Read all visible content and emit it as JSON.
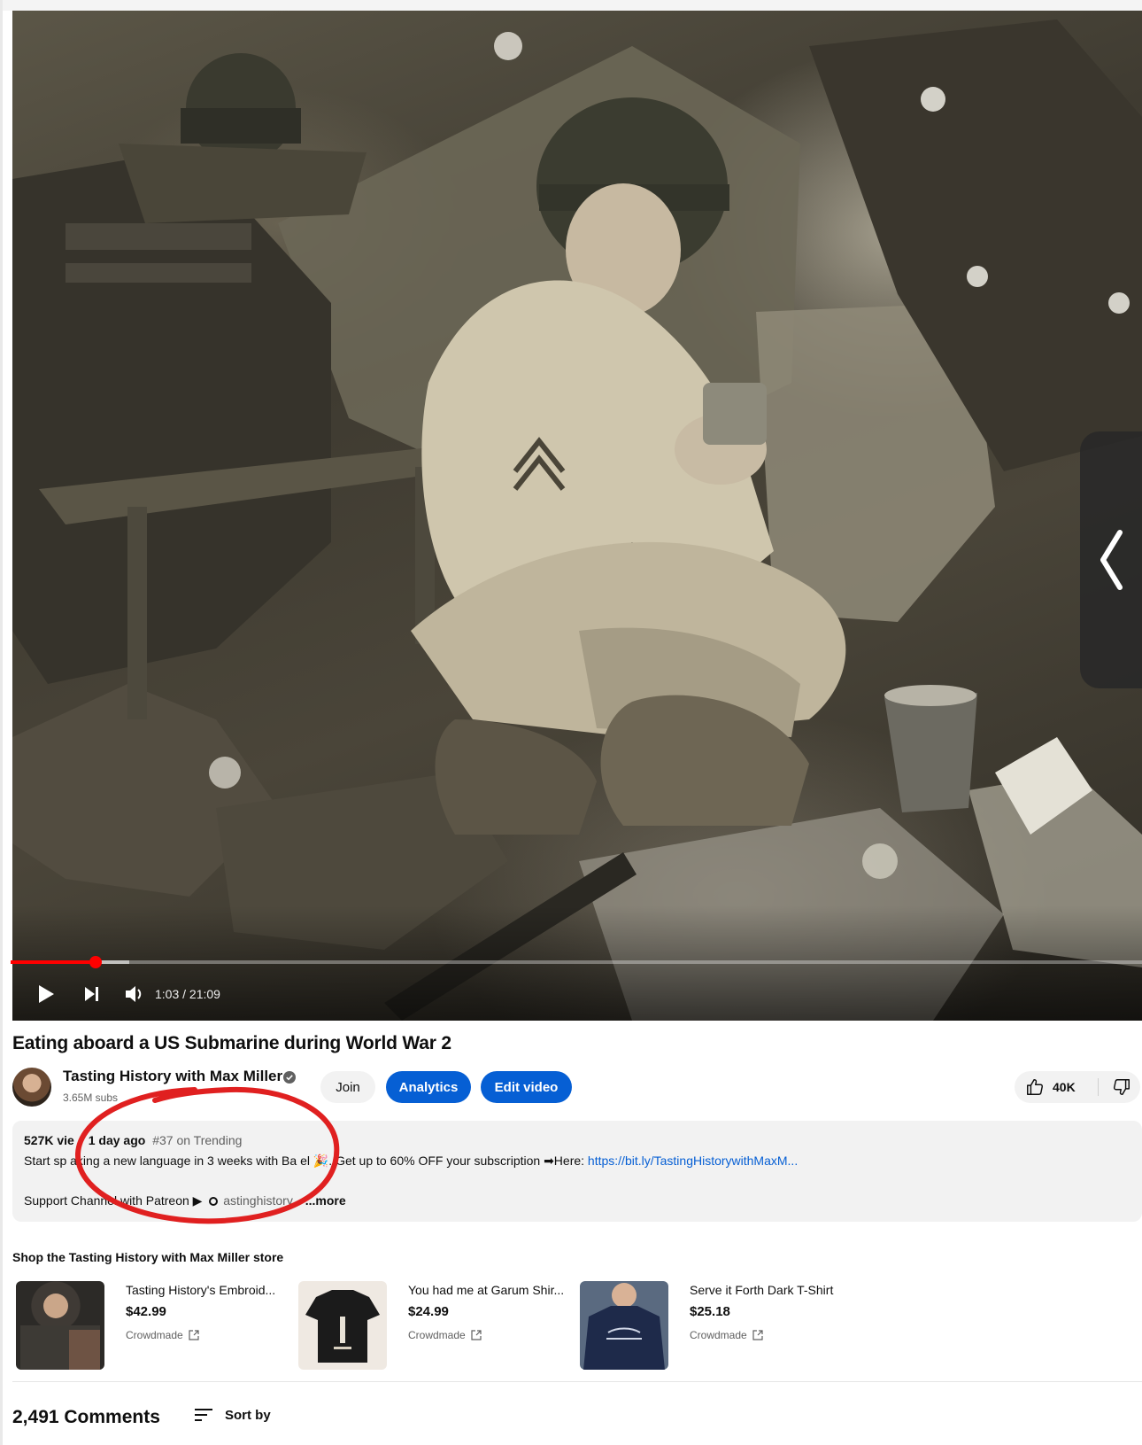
{
  "player": {
    "time": "1:03 / 21:09",
    "progress": 0.075,
    "buffered": 0.105
  },
  "video": {
    "title": "Eating aboard a US Submarine during World War 2"
  },
  "channel": {
    "name": "Tasting History with Max Miller",
    "subscribers": "3.65M subs"
  },
  "actions": {
    "join": "Join",
    "analytics": "Analytics",
    "edit_video": "Edit video",
    "likes": "40K"
  },
  "description": {
    "views": "527K vie",
    "age": "1 day ago",
    "trending": "#37 on Trending",
    "line1_text": "Start sp aking a new language in 3 weeks with Ba el 🎉. Get up to 60% OFF your subscription ➡Here:",
    "line1_link": "https://bit.ly/TastingHistorywithMaxM...",
    "line2_text": "Support Channel with Patreon ▶",
    "line2_handle": "astinghistory",
    "more": "...more"
  },
  "shop": {
    "title": "Shop the Tasting History with Max Miller store",
    "items": [
      {
        "name": "Tasting History's Embroid...",
        "price": "$42.99",
        "vendor": "Crowdmade"
      },
      {
        "name": "You had me at Garum Shir...",
        "price": "$24.99",
        "vendor": "Crowdmade"
      },
      {
        "name": "Serve it Forth Dark T-Shirt",
        "price": "$25.18",
        "vendor": "Crowdmade"
      }
    ]
  },
  "comments": {
    "count": "2,491 Comments",
    "sort_label": "Sort by"
  },
  "colors": {
    "accent_blue": "#065fd4",
    "progress_red": "#ff0000",
    "annotation_red": "#e02020"
  }
}
